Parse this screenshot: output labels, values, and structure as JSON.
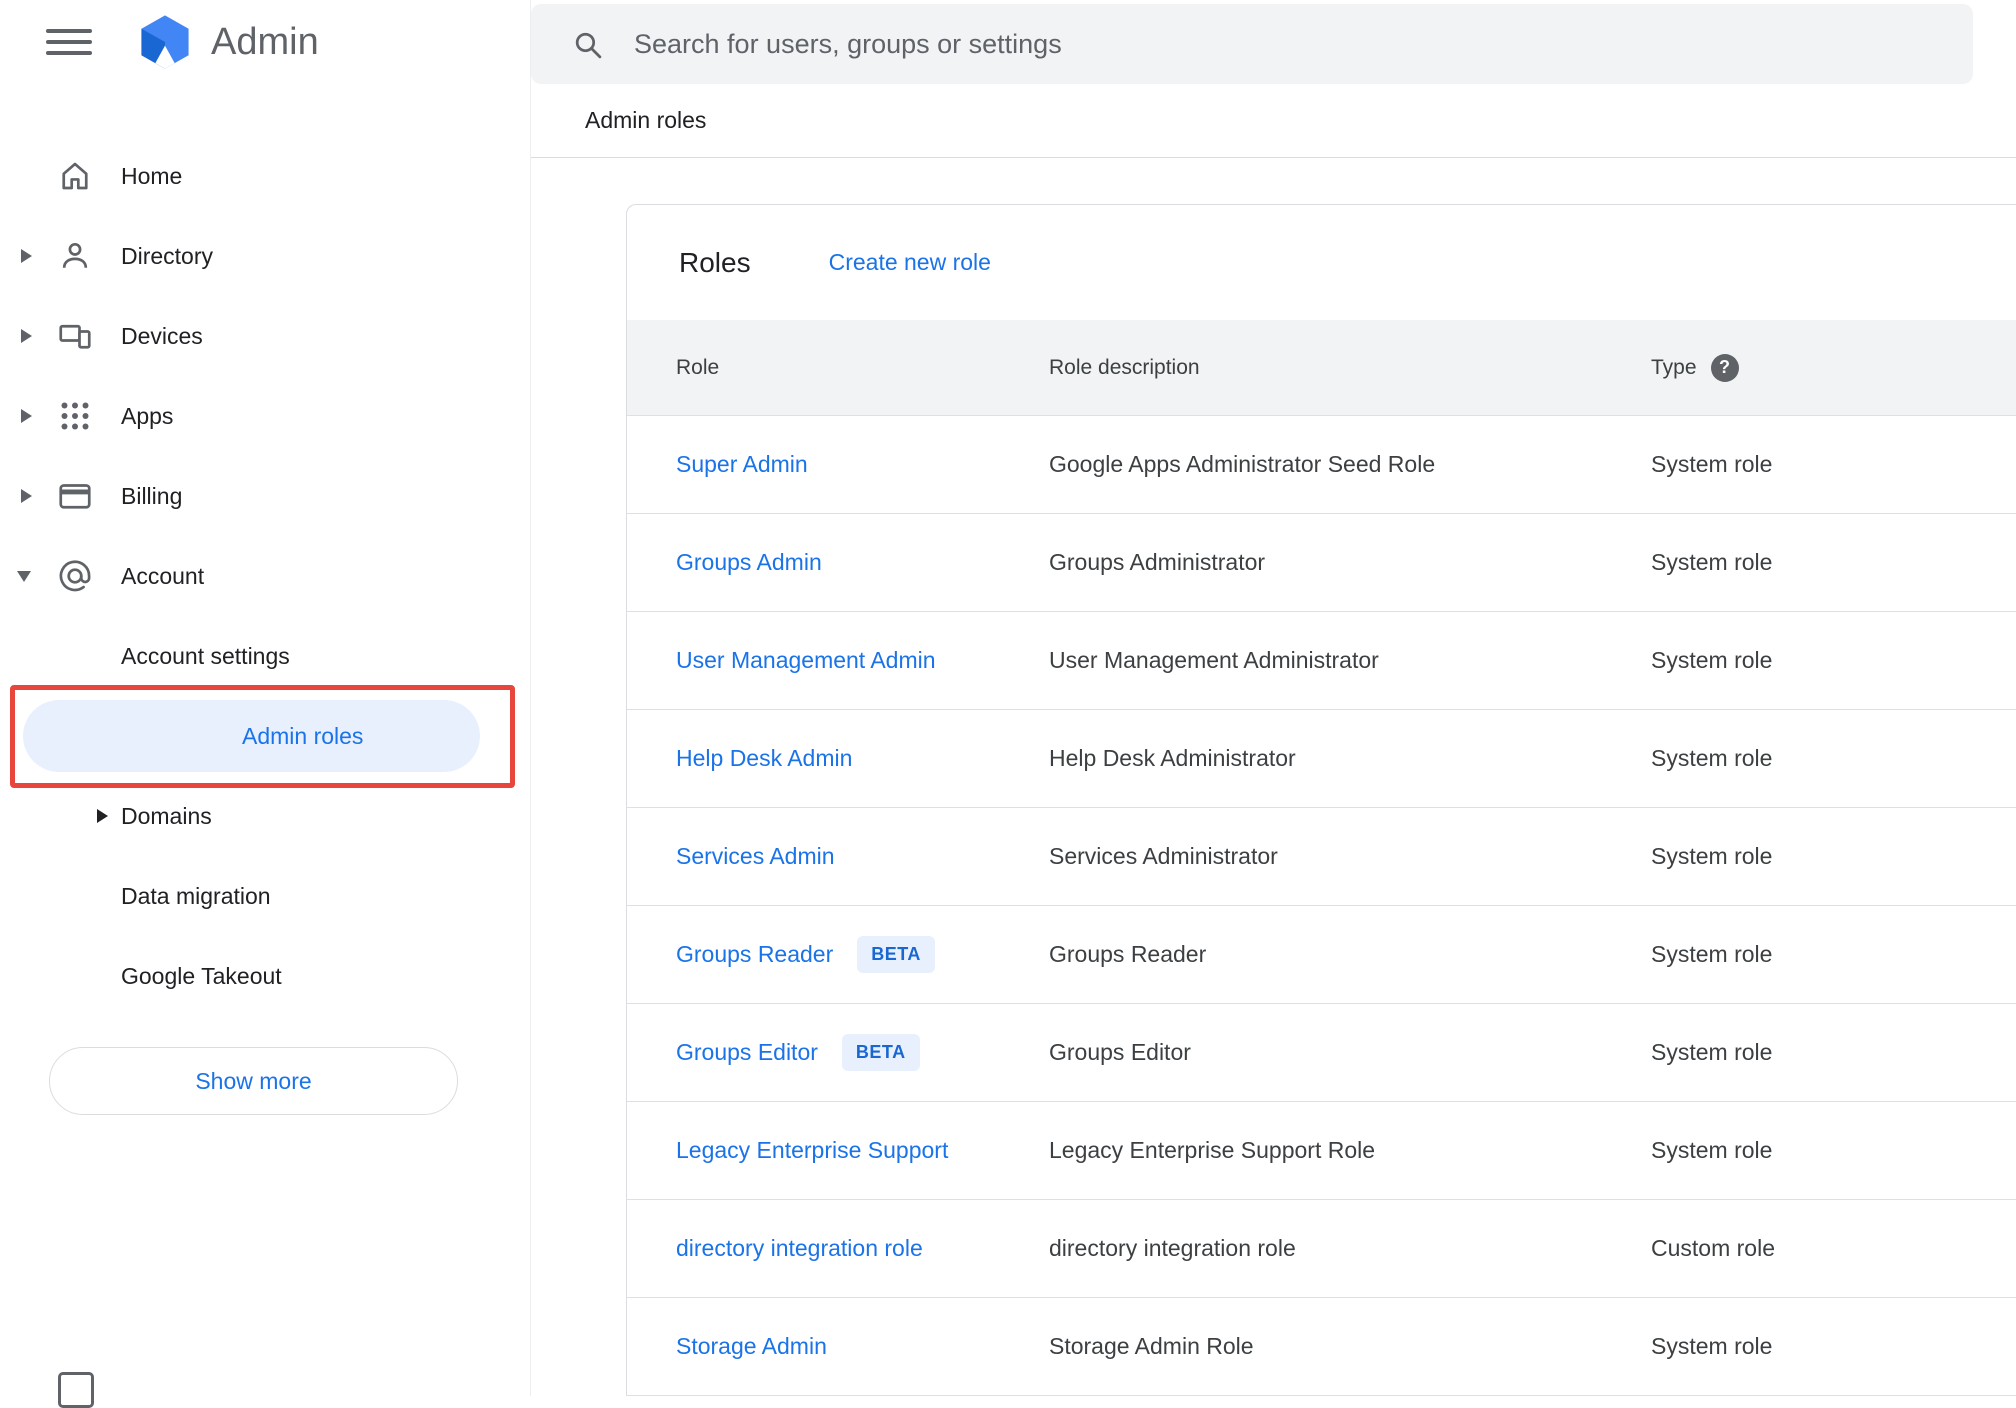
{
  "app": {
    "name": "Admin",
    "search_placeholder": "Search for users, groups or settings",
    "breadcrumb": "Admin roles"
  },
  "sidebar": {
    "items": [
      {
        "label": "Home",
        "icon": "home-icon"
      },
      {
        "label": "Directory",
        "icon": "directory-icon",
        "expandable": true
      },
      {
        "label": "Devices",
        "icon": "devices-icon",
        "expandable": true
      },
      {
        "label": "Apps",
        "icon": "apps-icon",
        "expandable": true
      },
      {
        "label": "Billing",
        "icon": "billing-icon",
        "expandable": true
      },
      {
        "label": "Account",
        "icon": "account-icon",
        "expanded": true
      }
    ],
    "account_children": [
      {
        "label": "Account settings"
      },
      {
        "label": "Admin roles",
        "selected": true
      },
      {
        "label": "Domains",
        "expandable": true
      },
      {
        "label": "Data migration"
      },
      {
        "label": "Google Takeout"
      }
    ],
    "show_more_label": "Show more"
  },
  "main": {
    "card_title": "Roles",
    "create_link": "Create new role",
    "beta_label": "BETA",
    "table": {
      "headers": [
        "Role",
        "Role description",
        "Type"
      ],
      "rows": [
        {
          "role": "Super Admin",
          "description": "Google Apps Administrator Seed Role",
          "type": "System role",
          "beta": false
        },
        {
          "role": "Groups Admin",
          "description": "Groups Administrator",
          "type": "System role",
          "beta": false
        },
        {
          "role": "User Management Admin",
          "description": "User Management Administrator",
          "type": "System role",
          "beta": false
        },
        {
          "role": "Help Desk Admin",
          "description": "Help Desk Administrator",
          "type": "System role",
          "beta": false
        },
        {
          "role": "Services Admin",
          "description": "Services Administrator",
          "type": "System role",
          "beta": false
        },
        {
          "role": "Groups Reader",
          "description": "Groups Reader",
          "type": "System role",
          "beta": true
        },
        {
          "role": "Groups Editor",
          "description": "Groups Editor",
          "type": "System role",
          "beta": true
        },
        {
          "role": "Legacy Enterprise Support",
          "description": "Legacy Enterprise Support Role",
          "type": "System role",
          "beta": false
        },
        {
          "role": "directory integration role",
          "description": "directory integration role",
          "type": "Custom role",
          "beta": false
        },
        {
          "role": "Storage Admin",
          "description": "Storage Admin Role",
          "type": "System role",
          "beta": false
        }
      ]
    }
  },
  "icons": {
    "help_glyph": "?"
  },
  "colors": {
    "accent": "#1a73e8",
    "selected_bg": "#e8f0fe",
    "annotation_red": "#e8453c",
    "header_bg": "#f1f3f4",
    "beta_bg": "#e8f0fe",
    "beta_text": "#1967d2"
  }
}
